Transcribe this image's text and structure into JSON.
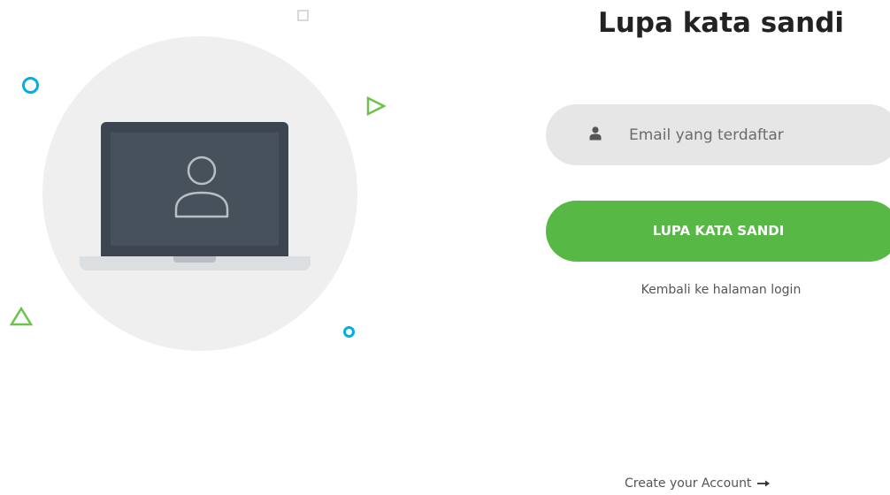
{
  "page_title": "Lupa kata sandi",
  "form": {
    "email_placeholder": "Email yang terdaftar",
    "email_value": "",
    "submit_label": "LUPA KATA SANDI",
    "back_link": "Kembali ke halaman login",
    "create_account_link": "Create your Account"
  },
  "colors": {
    "primary_button": "#57b846",
    "input_background": "#e6e6e6",
    "accent_blue": "#00aee8",
    "accent_green": "#6cc24a"
  },
  "icons": {
    "field": "user-icon",
    "arrow": "arrow-right-icon"
  }
}
